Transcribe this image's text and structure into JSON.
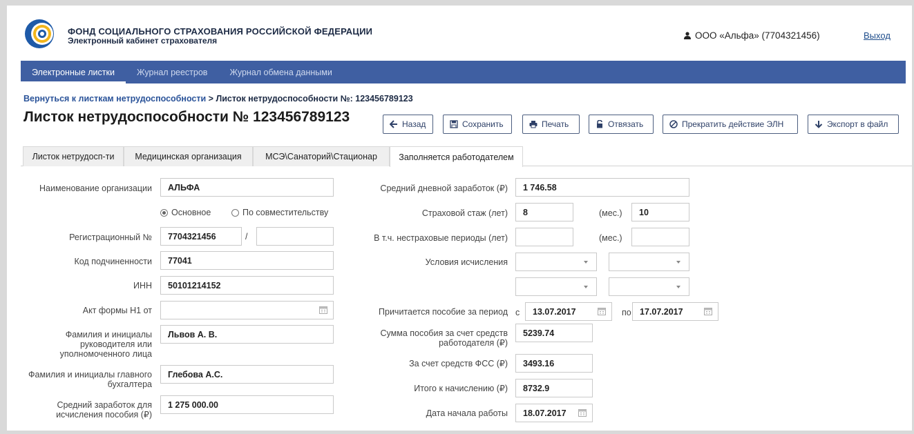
{
  "header": {
    "org_title": "ФОНД СОЦИАЛЬНОГО СТРАХОВАНИЯ РОССИЙСКОЙ ФЕДЕРАЦИИ",
    "org_subtitle": "Электронный кабинет страхователя",
    "user": "ООО «Альфа» (7704321456)",
    "exit": "Выход"
  },
  "nav": [
    "Электронные листки",
    "Журнал реестров",
    "Журнал обмена данными"
  ],
  "breadcrumb": {
    "link": "Вернуться к листкам нетрудоспособности",
    "current": "> Листок нетрудоспособности №: 123456789123"
  },
  "page_title": "Листок нетрудоспособности № 123456789123",
  "toolbar": {
    "back": "Назад",
    "save": "Сохранить",
    "print": "Печать",
    "unbind": "Отвязать",
    "terminate": "Прекратить действие ЭЛН",
    "export": "Экспорт в файл"
  },
  "tabs": [
    "Листок нетрудосп-ти",
    "Медицинская организация",
    "МСЭ\\Санаторий\\Стационар",
    "Заполняется работодателем"
  ],
  "left": {
    "org_name_label": "Наименование организации",
    "org_name": "АЛЬФА",
    "radio_main": "Основное",
    "radio_part": "По совместительству",
    "reg_label": "Регистрационный №",
    "reg": "7704321456",
    "reg_sep": "/",
    "reg2": "",
    "subord_label": "Код подчиненности",
    "subord": "77041",
    "inn_label": "ИНН",
    "inn": "50101214152",
    "act_label": "Акт формы Н1 от",
    "act": "",
    "head_label": "Фамилия и инициалы руководителя или уполномоченного лица",
    "head": "Львов А. В.",
    "acc_label": "Фамилия и инициалы главного бухгалтера",
    "acc": "Глебова А.С.",
    "avg_label": "Средний заработок для исчисления пособия (₽)",
    "avg": "1 275 000.00"
  },
  "right": {
    "daily_label": "Средний дневной заработок (₽)",
    "daily": "1 746.58",
    "exp_label": "Страховой стаж (лет)",
    "exp_years": "8",
    "mon_label": "(мес.)",
    "exp_months": "10",
    "nonins_label": "В т.ч. нестраховые периоды (лет)",
    "nonins_years": "",
    "nonins_months": "",
    "cond_label": "Условия исчисления",
    "period_label": "Причитается пособие за период",
    "from_label": "с",
    "from": "13.07.2017",
    "to_label": "по",
    "to": "17.07.2017",
    "employer_label": "Сумма пособия за счет средств работодателя (₽)",
    "employer": "5239.74",
    "fss_label": "За счет средств ФСС (₽)",
    "fss": "3493.16",
    "total_label": "Итого к начислению (₽)",
    "total": "8732.9",
    "start_label": "Дата начала работы",
    "start": "18.07.2017"
  },
  "colors": {
    "nav": "#3f5fa2",
    "link": "#2a5399",
    "logo_blue": "#1e5aa8",
    "logo_yellow": "#f2b51c"
  }
}
